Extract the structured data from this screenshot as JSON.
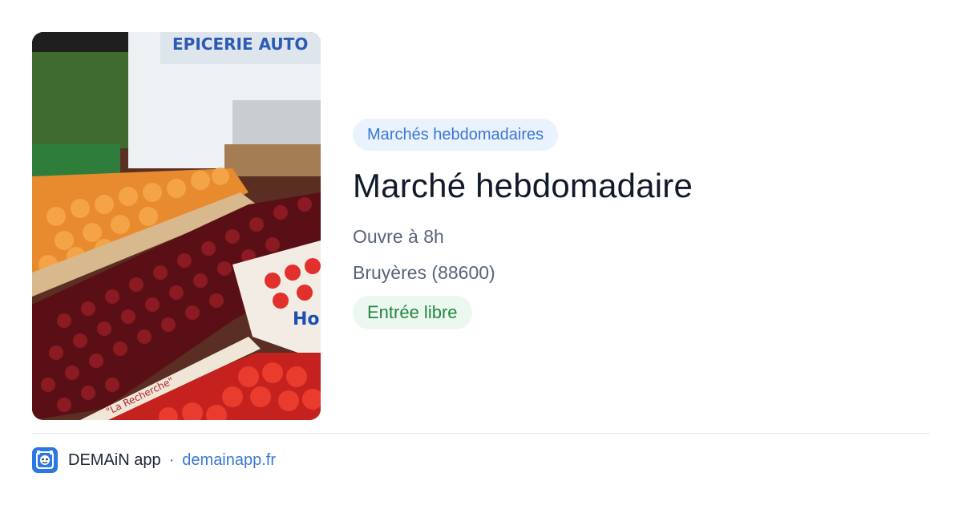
{
  "event": {
    "category": "Marchés hebdomadaires",
    "title": "Marché hebdomadaire",
    "hours": "Ouvre à 8h",
    "location": "Bruyères (88600)",
    "access": "Entrée libre"
  },
  "footer": {
    "app_name": "DEMAiN app",
    "separator": "·",
    "site": "demainapp.fr"
  },
  "colors": {
    "brand_blue": "#2b78e4",
    "category_text": "#3a78d4",
    "access_green": "#23873f"
  },
  "icons": {
    "app_logo": "demain-app-logo-icon"
  }
}
